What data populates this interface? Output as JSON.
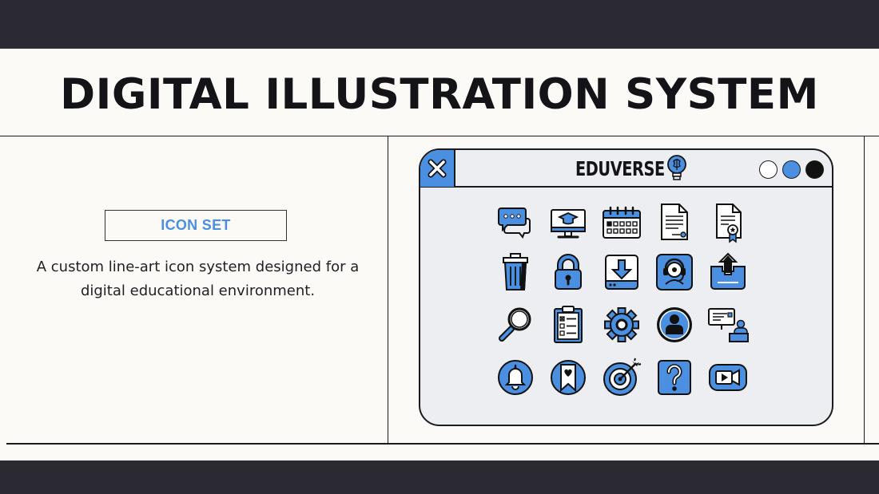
{
  "header": {
    "title": "DIGITAL ILLUSTRATION SYSTEM"
  },
  "left": {
    "tag": "ICON SET",
    "description_line1": "A custom line-art icon system designed for a",
    "description_line2": "digital educational environment."
  },
  "window": {
    "title": "EDUVERSE",
    "controls": [
      "close",
      "minimize",
      "maximize"
    ]
  },
  "icons": [
    "chat-bubbles-icon",
    "computer-graduation-cap-icon",
    "calendar-icon",
    "document-icon",
    "certificate-icon",
    "trash-bin-icon",
    "padlock-icon",
    "download-icon",
    "headset-support-icon",
    "upload-share-icon",
    "magnifier-icon",
    "clipboard-checklist-icon",
    "gear-icon",
    "user-profile-icon",
    "teacher-presentation-icon",
    "bell-icon",
    "bookmark-heart-icon",
    "target-icon",
    "question-mark-icon",
    "video-camera-icon"
  ],
  "colors": {
    "accent": "#4a8fe0",
    "dark": "#2b2a33",
    "background": "#fcfaf6",
    "window": "#edeef2"
  }
}
